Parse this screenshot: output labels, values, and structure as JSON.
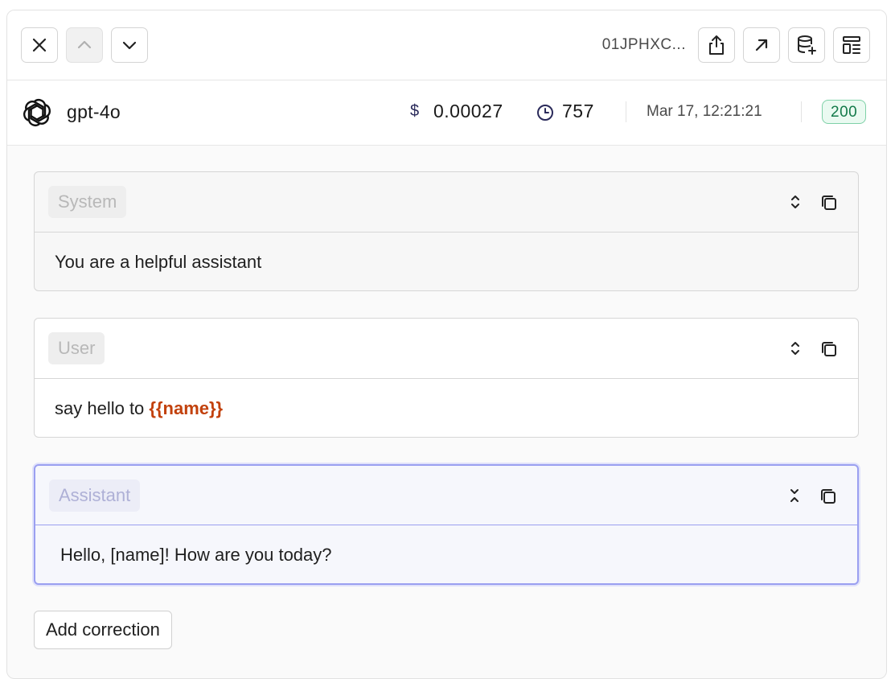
{
  "toolbar": {
    "request_id": "01JPHXC...",
    "icons": {
      "close": "close-icon",
      "prev": "chevron-up-icon",
      "next": "chevron-down-icon",
      "share": "share-icon",
      "open": "arrow-up-right-icon",
      "dataset": "database-add-icon",
      "layout": "layout-icon"
    }
  },
  "info": {
    "model": "gpt-4o",
    "cost": "0.00027",
    "cost_symbol": "$",
    "tokens": "757",
    "timestamp": "Mar 17, 12:21:21",
    "status": "200"
  },
  "messages": [
    {
      "role": "System",
      "content": "You are a helpful assistant"
    },
    {
      "role": "User",
      "content_prefix": "say hello to ",
      "variable": "{{name}}"
    },
    {
      "role": "Assistant",
      "content": "Hello, [name]! How are you today?"
    }
  ],
  "actions": {
    "add_correction": "Add correction"
  },
  "colors": {
    "status_green": "#137a4a",
    "variable_orange": "#c2410c",
    "assistant_border": "#9a9ff0"
  }
}
